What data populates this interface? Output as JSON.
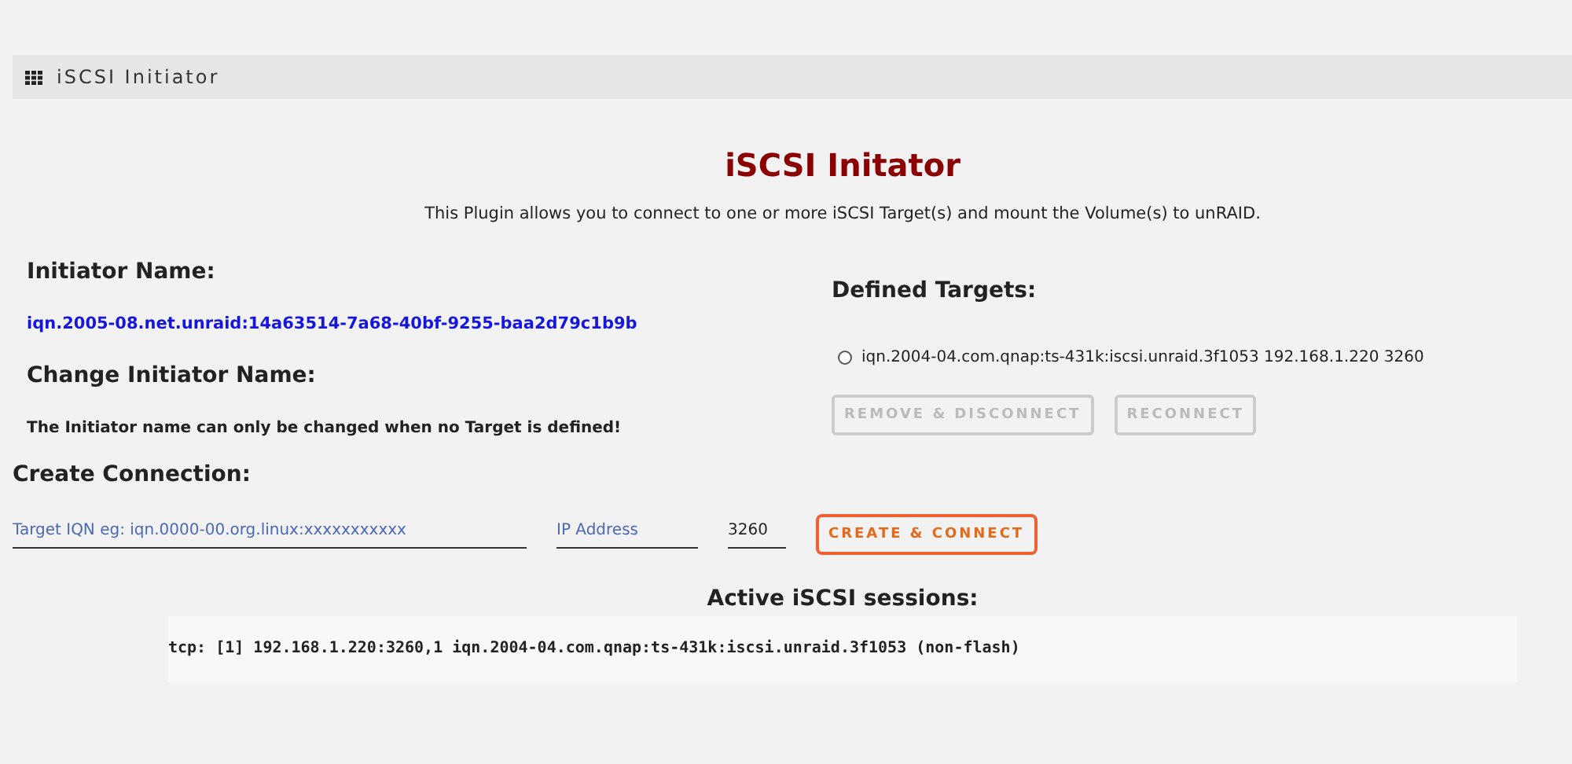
{
  "header": {
    "title": "iSCSI Initiator"
  },
  "page": {
    "title": "iSCSI Initator",
    "description": "This Plugin allows you to connect to one or more iSCSI Target(s) and mount the Volume(s) to unRAID."
  },
  "initiator": {
    "heading": "Initiator Name:",
    "name": "iqn.2005-08.net.unraid:14a63514-7a68-40bf-9255-baa2d79c1b9b",
    "change_heading": "Change Initiator Name:",
    "change_note": "The Initiator name can only be changed when no Target is defined!"
  },
  "targets": {
    "heading": "Defined Targets:",
    "items": [
      {
        "label": "iqn.2004-04.com.qnap:ts-431k:iscsi.unraid.3f1053 192.168.1.220 3260",
        "selected": false
      }
    ],
    "buttons": [
      {
        "label": "REMOVE & DISCONNECT",
        "disabled": true
      },
      {
        "label": "RECONNECT",
        "disabled": true
      }
    ]
  },
  "create_connection": {
    "heading": "Create Connection:",
    "iqn_field": {
      "placeholder": "Target IQN eg: iqn.0000-00.org.linux:xxxxxxxxxxx"
    },
    "ip_field": {
      "placeholder": "IP Address"
    },
    "port_field": {
      "value": "3260"
    },
    "button": {
      "label": "CREATE & CONNECT",
      "disabled": false
    }
  },
  "sessions": {
    "heading": "Active iSCSI sessions:",
    "output": "tcp: [1] 192.168.1.220:3260,1 iqn.2004-04.com.qnap:ts-431k:iscsi.unraid.3f1053 (non-flash)"
  }
}
